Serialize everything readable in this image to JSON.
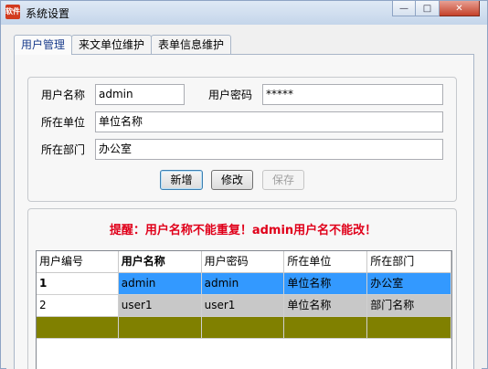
{
  "window": {
    "title": "系统设置",
    "icon_text": "软件",
    "controls": {
      "minimize": "—",
      "maximize": "□",
      "close": "✕"
    }
  },
  "tabs": [
    "用户管理",
    "来文单位维护",
    "表单信息维护"
  ],
  "form": {
    "username_label": "用户名称",
    "username_value": "admin",
    "password_label": "用户密码",
    "password_value": "*****",
    "unit_label": "所在单位",
    "unit_value": "单位名称",
    "dept_label": "所在部门",
    "dept_value": "办公室"
  },
  "buttons": {
    "add": "新增",
    "edit": "修改",
    "save": "保存"
  },
  "warning": "提醒：用户名称不能重复！admin用户名不能改！",
  "table": {
    "columns": [
      "用户编号",
      "用户名称",
      "用户密码",
      "所在单位",
      "所在部门"
    ],
    "rows": [
      [
        "1",
        "admin",
        "admin",
        "单位名称",
        "办公室"
      ],
      [
        "2",
        "user1",
        "user1",
        "单位名称",
        "部门名称"
      ]
    ]
  },
  "colors": {
    "selected_row": "#3399ff",
    "row_grey": "#c8c8c8",
    "new_row": "#808000",
    "warning": "#e0001a"
  }
}
